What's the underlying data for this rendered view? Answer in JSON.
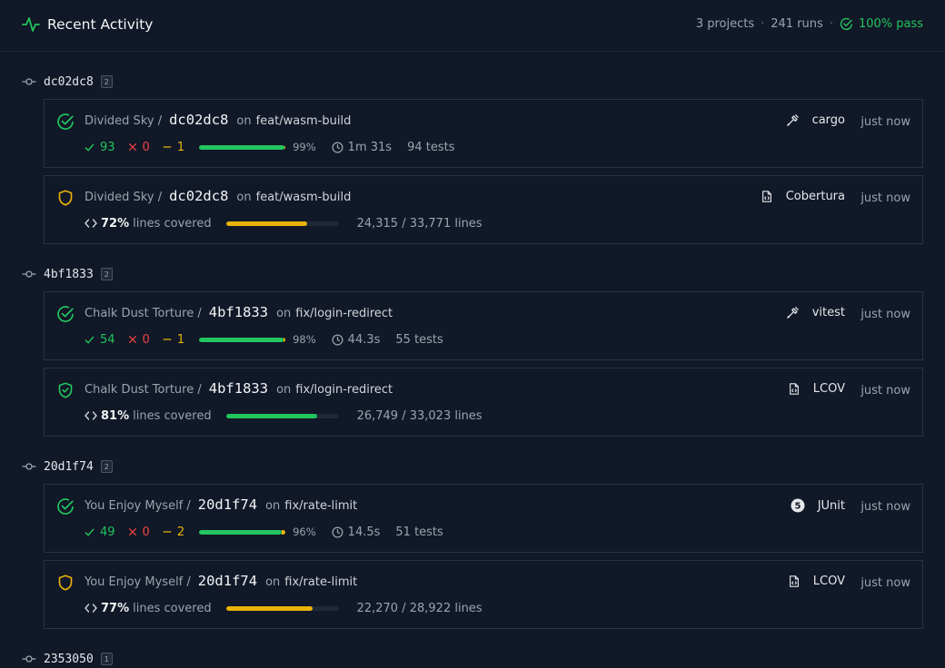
{
  "header": {
    "title": "Recent Activity",
    "projects": "3 projects",
    "runs": "241 runs",
    "pass": "100% pass"
  },
  "colors": {
    "pass": "#22c55e",
    "fail": "#ef4444",
    "skip": "#eab308",
    "background": "#111827"
  },
  "groups": [
    {
      "sha": "dc02dc8",
      "count": "2",
      "test_run": {
        "status_icon": "check-circle-icon",
        "project": "Divided Sky /",
        "sha": "dc02dc8",
        "on": "on",
        "branch": "feat/wasm-build",
        "tool": "cargo",
        "tool_icon": "wrench-icon",
        "when": "just now",
        "passed": "93",
        "failed": "0",
        "skipped": "1",
        "pass_rate": "99%",
        "pass_fraction": 0.99,
        "duration": "1m 31s",
        "tests": "94 tests"
      },
      "coverage": {
        "status_icon": "shield-outline-icon",
        "project": "Divided Sky /",
        "sha": "dc02dc8",
        "on": "on",
        "branch": "feat/wasm-build",
        "tool": "Cobertura",
        "tool_icon": "file-code-icon",
        "when": "just now",
        "percent": "72%",
        "percent_fraction": 0.72,
        "label": "lines covered",
        "lines": "24,315 / 33,771 lines",
        "bar_color": "#eab308"
      }
    },
    {
      "sha": "4bf1833",
      "count": "2",
      "test_run": {
        "status_icon": "check-circle-icon",
        "project": "Chalk Dust Torture /",
        "sha": "4bf1833",
        "on": "on",
        "branch": "fix/login-redirect",
        "tool": "vitest",
        "tool_icon": "wrench-icon",
        "when": "just now",
        "passed": "54",
        "failed": "0",
        "skipped": "1",
        "pass_rate": "98%",
        "pass_fraction": 0.98,
        "duration": "44.3s",
        "tests": "55 tests"
      },
      "coverage": {
        "status_icon": "shield-check-icon",
        "project": "Chalk Dust Torture /",
        "sha": "4bf1833",
        "on": "on",
        "branch": "fix/login-redirect",
        "tool": "LCOV",
        "tool_icon": "file-code-icon",
        "when": "just now",
        "percent": "81%",
        "percent_fraction": 0.81,
        "label": "lines covered",
        "lines": "26,749 / 33,023 lines",
        "bar_color": "#22c55e"
      }
    },
    {
      "sha": "20d1f74",
      "count": "2",
      "test_run": {
        "status_icon": "check-circle-icon",
        "project": "You Enjoy Myself /",
        "sha": "20d1f74",
        "on": "on",
        "branch": "fix/rate-limit",
        "tool": "JUnit",
        "tool_icon": "junit-5-icon",
        "when": "just now",
        "passed": "49",
        "failed": "0",
        "skipped": "2",
        "pass_rate": "96%",
        "pass_fraction": 0.96,
        "duration": "14.5s",
        "tests": "51 tests"
      },
      "coverage": {
        "status_icon": "shield-outline-icon",
        "project": "You Enjoy Myself /",
        "sha": "20d1f74",
        "on": "on",
        "branch": "fix/rate-limit",
        "tool": "LCOV",
        "tool_icon": "file-code-icon",
        "when": "just now",
        "percent": "77%",
        "percent_fraction": 0.77,
        "label": "lines covered",
        "lines": "22,270 / 28,922 lines",
        "bar_color": "#eab308"
      }
    },
    {
      "sha": "2353050",
      "count": "1"
    }
  ]
}
